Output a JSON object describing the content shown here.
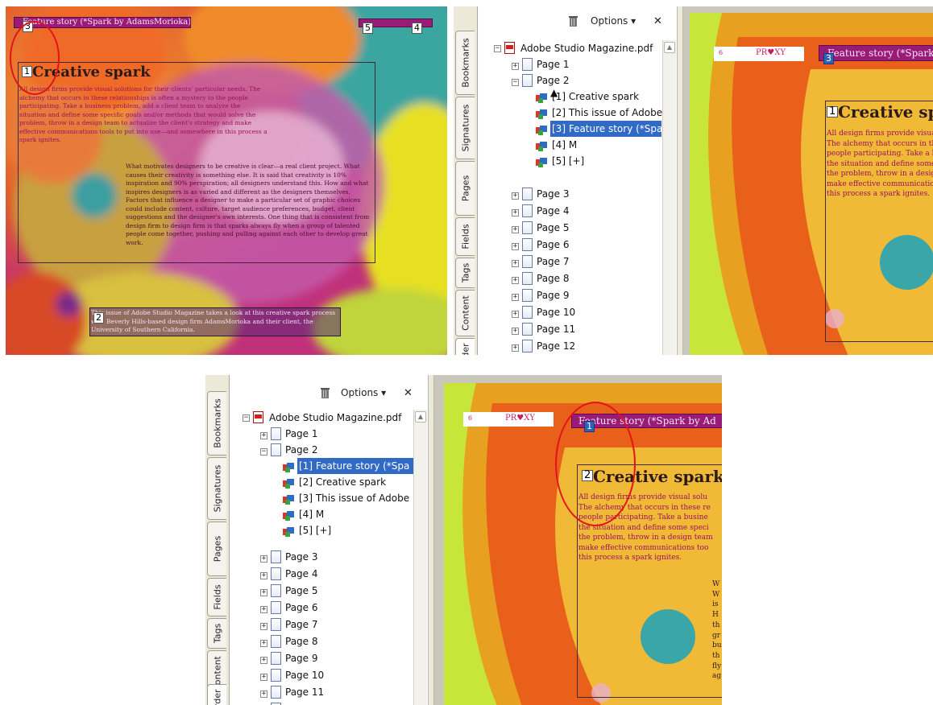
{
  "panel1": {
    "title_bar": "Feature story (*Spark by AdamsMorioka)",
    "heading": "Creative spark",
    "para1": "All design firms provide visual solutions for their clients' particular needs. The alchemy that occurs in these relationships is often a mystery to the people participating. Take a business problem, add a client team to analyze the situation and define some specific goals and/or methods that would solve the problem, throw in a design team to actualize the client's strategy and make effective communications tools to put into use—and somewhere in this process a spark ignites.",
    "para2": "What motivates designers to be creative is clear—a real client project. What causes their creativity is something else. It is said that creativity is 10% inspiration and 90% perspiration; all designers understand this. How and what inspires designers is as varied and different as the designers themselves. Factors that influence a designer to make a particular set of graphic choices could include content, culture, target audience preferences, budget, client suggestions and the designer's own interests. One thing that is consistent from design firm to design firm is that sparks always fly when a group of talented people come together, pushing and pulling against each other to develop great work.",
    "caption": "This issue of Adobe Studio Magazine takes a look at this creative spark process with Beverly Hills-based design firm AdamsMorioka and their client, the University of Southern California.",
    "tags": [
      "3",
      "1",
      "2",
      "5",
      "4"
    ]
  },
  "tabs": [
    "Bookmarks",
    "Signatures",
    "Pages",
    "Fields",
    "Tags",
    "Content",
    "Order"
  ],
  "toolbar": {
    "options_label": "Options",
    "options_arrow": "▾",
    "close_label": "✕"
  },
  "tree": {
    "root": "Adobe Studio Magazine.pdf",
    "pages": [
      "Page 1",
      "Page 2",
      "Page 3",
      "Page 4",
      "Page 5",
      "Page 6",
      "Page 7",
      "Page 8",
      "Page 9",
      "Page 10",
      "Page 11",
      "Page 12"
    ]
  },
  "panel2": {
    "children": [
      "[1] Creative spark",
      "[2] This issue of Adobe",
      "[3] Feature story (*Spa",
      "[4] M",
      "[5] [+]"
    ],
    "selected_index": 2,
    "proxy_num": "6",
    "proxy_logo": "PR♥XY",
    "title_bar": "Feature story (*Spark b",
    "tag_bar": "3",
    "heading": "Creative spar",
    "tag_heading": "1",
    "lines": [
      "All design firms provide visual",
      "The alchemy that occurs in the",
      "people participating. Take a b",
      "the situation and define some",
      "the problem, throw in a design",
      "make effective communication",
      "this process a spark ignites."
    ]
  },
  "panel3": {
    "children": [
      "[1] Feature story (*Spa",
      "[2] Creative spark",
      "[3] This issue of Adobe",
      "[4] M",
      "[5] [+]"
    ],
    "selected_index": 0,
    "proxy_num": "6",
    "proxy_logo": "PR♥XY",
    "title_bar": "Feature story (*Spark by Ad",
    "tag_bar": "1",
    "heading": "Creative spark",
    "tag_heading": "2",
    "lines": [
      "All design firms provide visual solu",
      "The alchemy that occurs in these re",
      "people participating. Take a busine",
      "the situation and define some speci",
      "the problem, throw in a design team",
      "make effective communications too",
      "this process a spark ignites."
    ],
    "right_col": [
      "W",
      "W",
      "is",
      "H",
      "th",
      "gr",
      "bu",
      "th",
      "fly",
      "ag"
    ]
  },
  "colors": {
    "selection": "#316ac5",
    "annotation": "#e4121b",
    "tag_blue": "#2d64b8",
    "text_magenta": "#9b1060"
  }
}
